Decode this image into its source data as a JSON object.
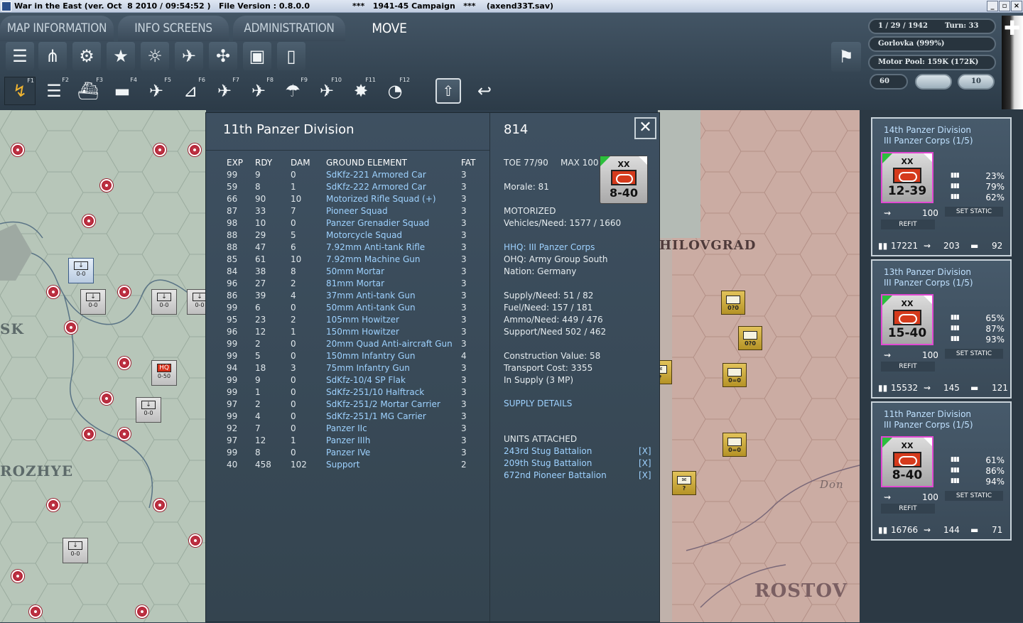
{
  "window": {
    "title": "War in the East (ver. Oct  8 2010 / 09:54:52 )   File Version : 0.8.0.0",
    "campaign": "***   1941-45 Campaign   ***    (axend33T.sav)"
  },
  "tabs": {
    "map_info": "MAP INFORMATION",
    "info_screens": "INFO SCREENS",
    "administration": "ADMINISTRATION",
    "mode": "MOVE"
  },
  "fkeys": [
    "F1",
    "F2",
    "F3",
    "F4",
    "F5",
    "F6",
    "F7",
    "F8",
    "F9",
    "F10",
    "F11",
    "F12"
  ],
  "status": {
    "date": "1 / 29 / 1942",
    "turn": "Turn: 33",
    "location": "Gorlovka  (999%)",
    "motor_pool": "Motor Pool:  159K (172K)",
    "value_a": "60",
    "value_b": "10"
  },
  "map": {
    "left_labels": [
      "SK",
      "ROZHYE"
    ],
    "right_labels": [
      "HILOVGRAD",
      "ROSTOV",
      "Don"
    ]
  },
  "unit_panel": {
    "title": "11th Panzer Division",
    "headers": {
      "exp": "EXP",
      "rdy": "RDY",
      "dam": "DAM",
      "element": "GROUND ELEMENT",
      "fat": "FAT"
    },
    "elements": [
      {
        "exp": "99",
        "rdy": "9",
        "dam": "0",
        "name": "SdKfz-221 Armored Car",
        "fat": "3"
      },
      {
        "exp": "59",
        "rdy": "8",
        "dam": "1",
        "name": "SdKfz-222 Armored Car",
        "fat": "3"
      },
      {
        "exp": "66",
        "rdy": "90",
        "dam": "10",
        "name": "Motorized Rifle Squad (+)",
        "fat": "3"
      },
      {
        "exp": "87",
        "rdy": "33",
        "dam": "7",
        "name": "Pioneer Squad",
        "fat": "3"
      },
      {
        "exp": "98",
        "rdy": "10",
        "dam": "0",
        "name": "Panzer Grenadier Squad",
        "fat": "3"
      },
      {
        "exp": "88",
        "rdy": "29",
        "dam": "5",
        "name": "Motorcycle Squad",
        "fat": "3"
      },
      {
        "exp": "88",
        "rdy": "47",
        "dam": "6",
        "name": "7.92mm Anti-tank Rifle",
        "fat": "3"
      },
      {
        "exp": "85",
        "rdy": "61",
        "dam": "10",
        "name": "7.92mm Machine Gun",
        "fat": "3"
      },
      {
        "exp": "84",
        "rdy": "38",
        "dam": "8",
        "name": "50mm Mortar",
        "fat": "3"
      },
      {
        "exp": "96",
        "rdy": "27",
        "dam": "2",
        "name": "81mm Mortar",
        "fat": "3"
      },
      {
        "exp": "86",
        "rdy": "39",
        "dam": "4",
        "name": "37mm Anti-tank Gun",
        "fat": "3"
      },
      {
        "exp": "99",
        "rdy": "6",
        "dam": "0",
        "name": "50mm Anti-tank Gun",
        "fat": "3"
      },
      {
        "exp": "95",
        "rdy": "23",
        "dam": "2",
        "name": "105mm Howitzer",
        "fat": "3"
      },
      {
        "exp": "96",
        "rdy": "12",
        "dam": "1",
        "name": "150mm Howitzer",
        "fat": "3"
      },
      {
        "exp": "99",
        "rdy": "2",
        "dam": "0",
        "name": "20mm Quad Anti-aircraft Gun",
        "fat": "3"
      },
      {
        "exp": "99",
        "rdy": "5",
        "dam": "0",
        "name": "150mm Infantry Gun",
        "fat": "4"
      },
      {
        "exp": "94",
        "rdy": "18",
        "dam": "3",
        "name": "75mm Infantry Gun",
        "fat": "3"
      },
      {
        "exp": "99",
        "rdy": "9",
        "dam": "0",
        "name": "SdKfz-10/4 SP Flak",
        "fat": "3"
      },
      {
        "exp": "99",
        "rdy": "1",
        "dam": "0",
        "name": "SdKfz-251/10 Halftrack",
        "fat": "3"
      },
      {
        "exp": "97",
        "rdy": "2",
        "dam": "0",
        "name": "SdKfz-251/2 Mortar Carrier",
        "fat": "3"
      },
      {
        "exp": "99",
        "rdy": "4",
        "dam": "0",
        "name": "SdKfz-251/1 MG Carrier",
        "fat": "3"
      },
      {
        "exp": "92",
        "rdy": "7",
        "dam": "0",
        "name": "Panzer IIc",
        "fat": "3"
      },
      {
        "exp": "97",
        "rdy": "12",
        "dam": "1",
        "name": "Panzer IIIh",
        "fat": "3"
      },
      {
        "exp": "99",
        "rdy": "8",
        "dam": "0",
        "name": "Panzer IVe",
        "fat": "3"
      },
      {
        "exp": "40",
        "rdy": "458",
        "dam": "102",
        "name": "Support",
        "fat": "2"
      }
    ],
    "right": {
      "unit_id": "814",
      "toe": "TOE 77/90",
      "max": "MAX 100",
      "morale": "Morale:   81",
      "motorized": "MOTORIZED",
      "vehicles": "Vehicles/Need:   1577 / 1660",
      "hhq": "HHQ: III Panzer Corps",
      "ohq": "OHQ: Army Group South",
      "nation": "Nation:   Germany",
      "supply": "Supply/Need:   51 / 82",
      "fuel": "Fuel/Need:       157 / 181",
      "ammo": "Ammo/Need:    449 / 476",
      "support": "Support/Need    502 / 462",
      "construction": "Construction Value:   58",
      "transport": "Transport Cost:      3355",
      "in_supply": "In Supply (3 MP)",
      "supply_details": "SUPPLY DETAILS",
      "attached_header": "UNITS ATTACHED",
      "attached": [
        {
          "name": "243rd Stug Battalion",
          "x": "[X]"
        },
        {
          "name": "209th Stug Battalion",
          "x": "[X]"
        },
        {
          "name": "672nd Pioneer Battalion",
          "x": "[X]"
        }
      ],
      "counter": {
        "size": "XX",
        "strength": "8-40"
      }
    }
  },
  "sidebar": {
    "units": [
      {
        "name": "14th Panzer Division",
        "corps": "III Panzer Corps (1/5)",
        "size": "XX",
        "strength": "12-39",
        "p1": "23%",
        "p2": "79%",
        "p3": "62%",
        "mot": "100",
        "refit": "REFIT",
        "set_static": "SET STATIC",
        "men": "17221",
        "guns": "203",
        "tanks": "92"
      },
      {
        "name": "13th Panzer Division",
        "corps": "III Panzer Corps (1/5)",
        "size": "XX",
        "strength": "15-40",
        "p1": "65%",
        "p2": "87%",
        "p3": "93%",
        "mot": "100",
        "refit": "REFIT",
        "set_static": "SET STATIC",
        "men": "15532",
        "guns": "145",
        "tanks": "121"
      },
      {
        "name": "11th Panzer Division",
        "corps": "III Panzer Corps (1/5)",
        "size": "XX",
        "strength": "8-40",
        "p1": "61%",
        "p2": "86%",
        "p3": "94%",
        "mot": "100",
        "refit": "REFIT",
        "set_static": "SET STATIC",
        "men": "16766",
        "guns": "144",
        "tanks": "71"
      }
    ]
  },
  "counters_left": [
    "0-0",
    "0-0",
    "0-0",
    "0-0",
    "0-50",
    "0-0",
    "0-0"
  ],
  "counters_right": [
    "0?0",
    "0?0",
    "0=0",
    "0=0",
    "?",
    "?"
  ],
  "colors": {
    "panel": "#3a4b5a",
    "link": "#9ed2ff",
    "panzer_red": "#d53a1c",
    "selected_border": "#e14ad2"
  }
}
